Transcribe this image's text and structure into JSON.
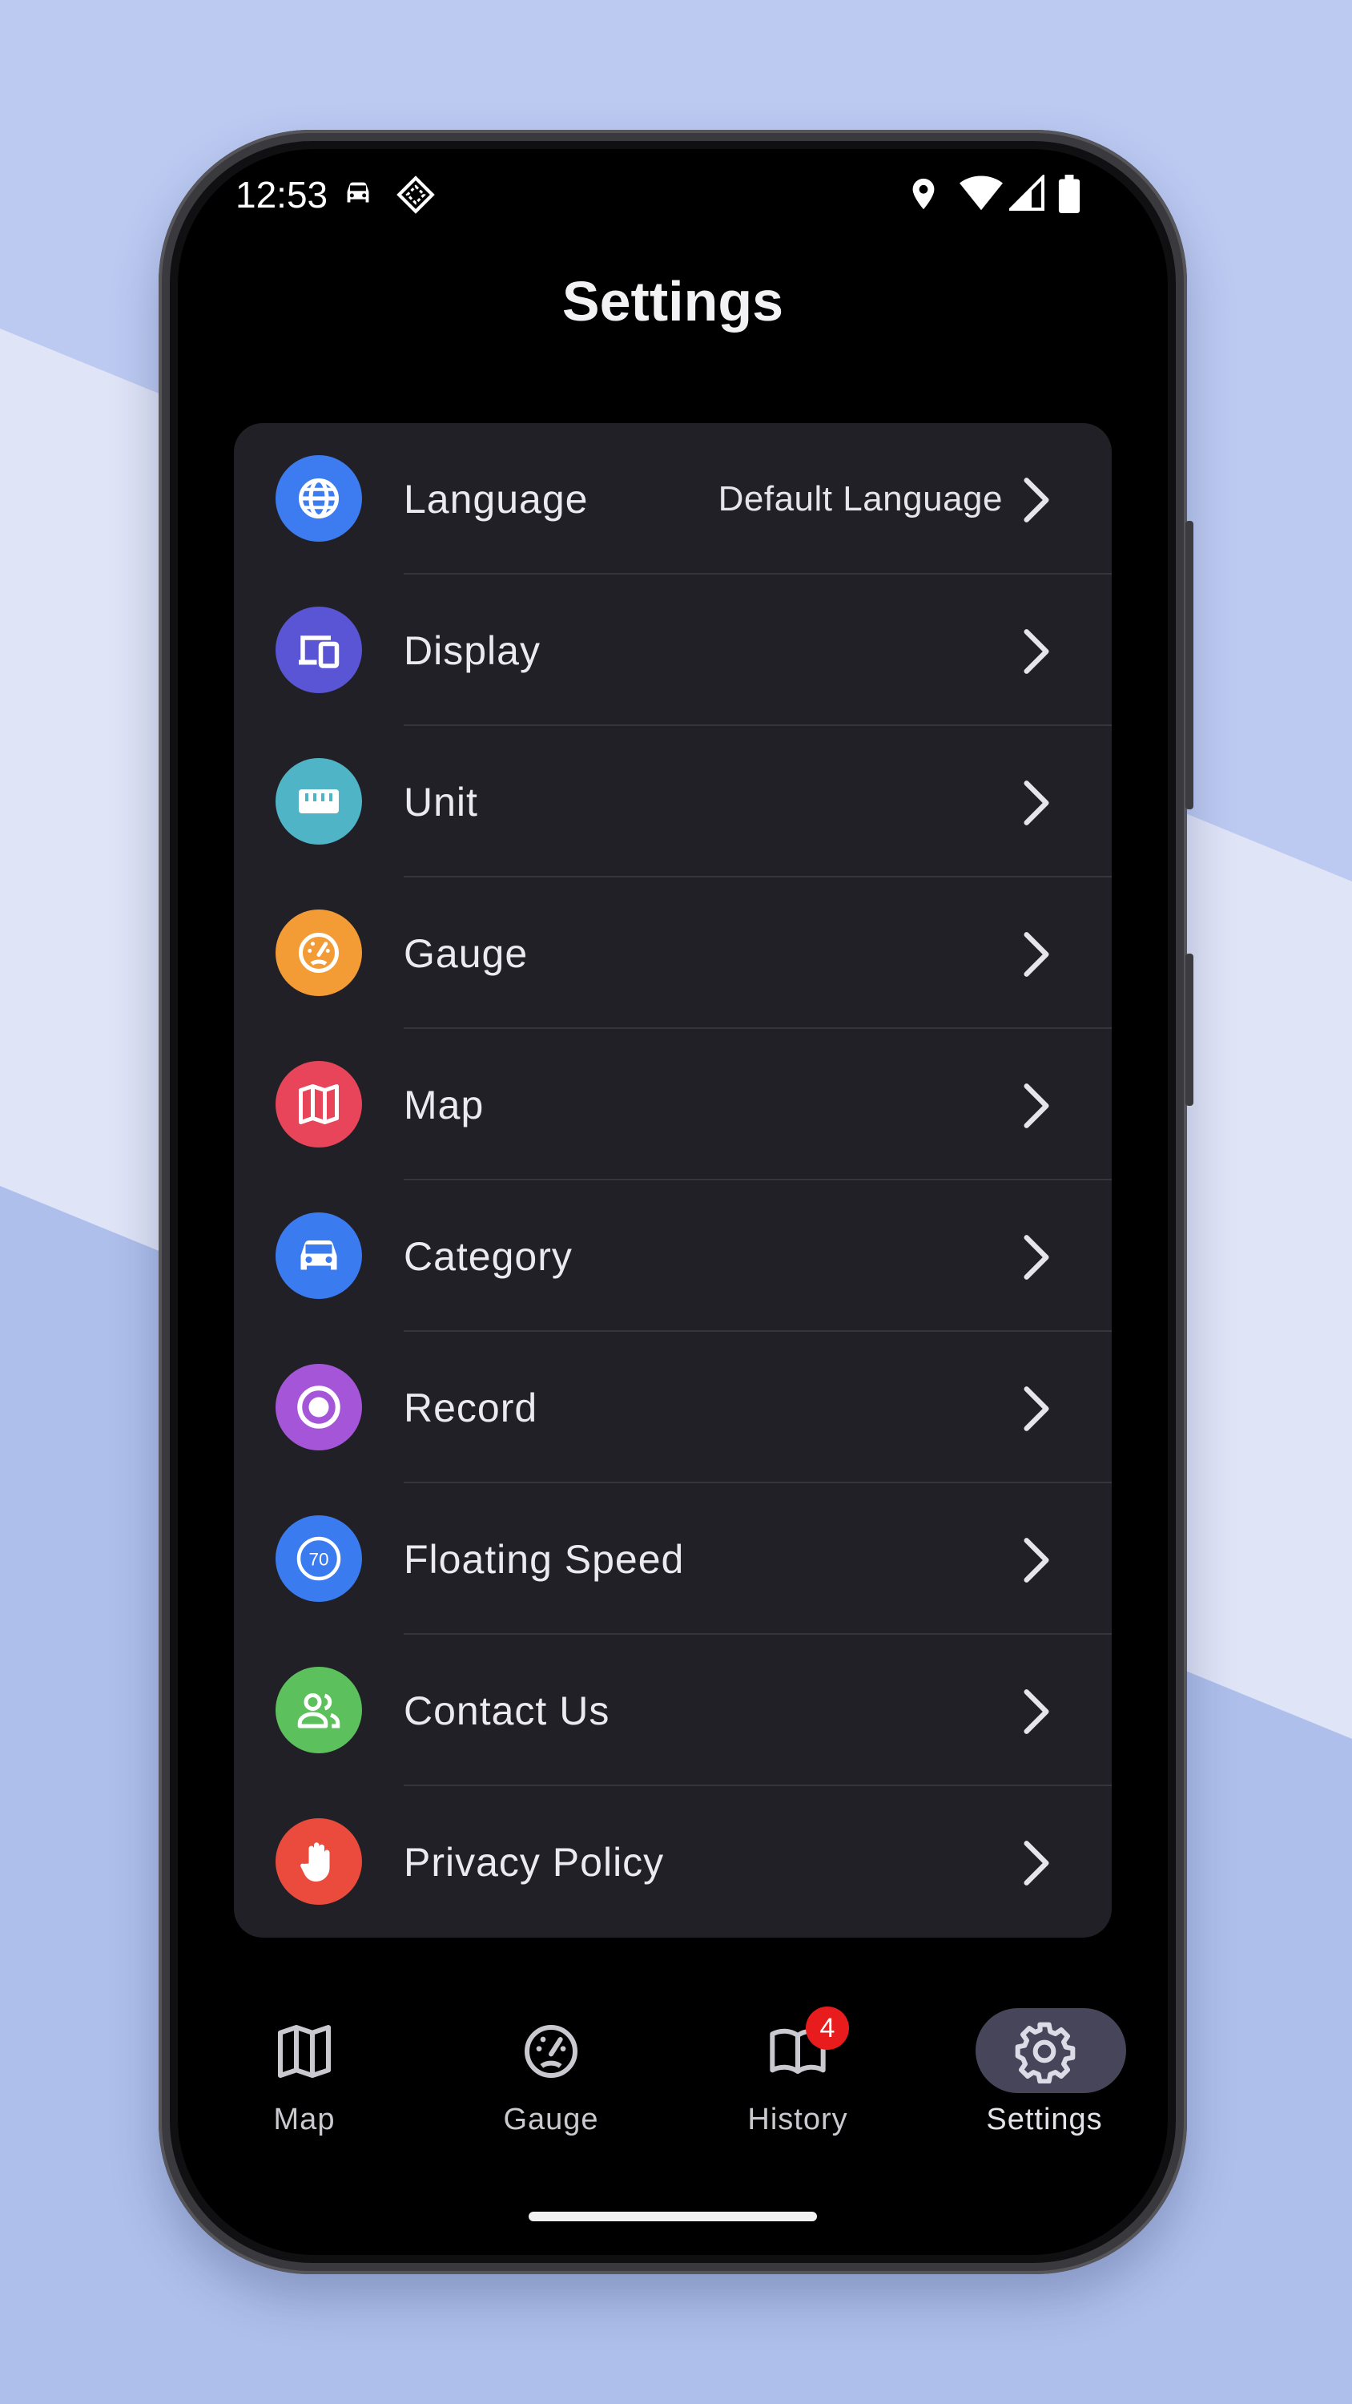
{
  "status_bar": {
    "time": "12:53",
    "icons": [
      "car-icon",
      "cast-diamond-icon",
      "location-pin-icon",
      "wifi-icon",
      "cell-signal-icon",
      "battery-icon"
    ]
  },
  "page": {
    "title": "Settings"
  },
  "settings": [
    {
      "label": "Language",
      "value": "Default Language",
      "icon": "globe-icon",
      "color": "#3c7cf0"
    },
    {
      "label": "Display",
      "value": "",
      "icon": "devices-icon",
      "color": "#5a55d4"
    },
    {
      "label": "Unit",
      "value": "",
      "icon": "ruler-icon",
      "color": "#4fb4c6"
    },
    {
      "label": "Gauge",
      "value": "",
      "icon": "gauge-icon",
      "color": "#f39b35"
    },
    {
      "label": "Map",
      "value": "",
      "icon": "map-icon",
      "color": "#e8455a"
    },
    {
      "label": "Category",
      "value": "",
      "icon": "car-icon",
      "color": "#3a7bf0"
    },
    {
      "label": "Record",
      "value": "",
      "icon": "record-icon",
      "color": "#a556d8"
    },
    {
      "label": "Floating Speed",
      "value": "",
      "icon": "speed-limit-icon",
      "color": "#3a7bf0",
      "icon_text": "70"
    },
    {
      "label": "Contact Us",
      "value": "",
      "icon": "people-icon",
      "color": "#5cc05c"
    },
    {
      "label": "Privacy Policy",
      "value": "",
      "icon": "hand-icon",
      "color": "#ea4b3c"
    }
  ],
  "nav": {
    "items": [
      {
        "label": "Map",
        "icon": "map-icon"
      },
      {
        "label": "Gauge",
        "icon": "gauge-icon"
      },
      {
        "label": "History",
        "icon": "book-icon",
        "badge": "4"
      },
      {
        "label": "Settings",
        "icon": "gear-icon",
        "selected": true
      }
    ]
  },
  "colors": {
    "background": "#000000",
    "card": "#212026",
    "nav_selected_pill": "#46455a",
    "badge": "#e81c1c"
  }
}
